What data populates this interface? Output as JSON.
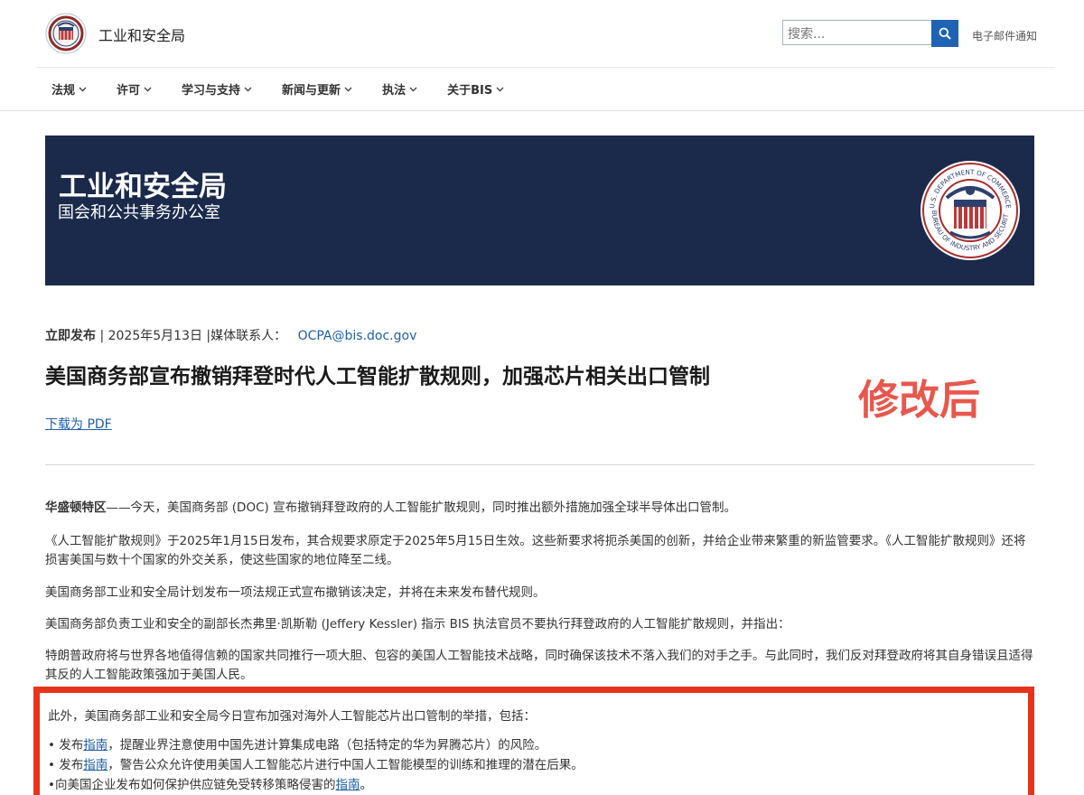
{
  "header": {
    "site_name": "工业和安全局",
    "search_placeholder": "搜索...",
    "email_link": "电子邮件通知"
  },
  "nav": [
    {
      "label": "法规"
    },
    {
      "label": "许可"
    },
    {
      "label": "学习与支持"
    },
    {
      "label": "新闻与更新"
    },
    {
      "label": "执法"
    },
    {
      "label": "关于BIS"
    }
  ],
  "banner": {
    "title": "工业和安全局",
    "subtitle": "国会和公共事务办公室",
    "seal_text_top": "U.S. DEPARTMENT OF COMMERCE",
    "seal_text_bottom": "BUREAU OF INDUSTRY AND SECURITY"
  },
  "meta": {
    "release_label": "立即发布",
    "date": "| 2025年5月13日 |媒体联系人：",
    "email": "OCPA@bis.doc.gov"
  },
  "headline": "美国商务部宣布撤销拜登时代人工智能扩散规则，加强芯片相关出口管制",
  "stamp": "修改后",
  "pdf_link": "下载为 PDF",
  "body": {
    "p1_lead": "华盛顿特区",
    "p1_rest": "——今天，美国商务部 (DOC) 宣布撤销拜登政府的人工智能扩散规则，同时推出额外措施加强全球半导体出口管制。",
    "p2": "《人工智能扩散规则》于2025年1月15日发布，其合规要求原定于2025年5月15日生效。这些新要求将扼杀美国的创新，并给企业带来繁重的新监管要求。《人工智能扩散规则》还将损害美国与数十个国家的外交关系，使这些国家的地位降至二线。",
    "p3": "美国商务部工业和安全局计划发布一项法规正式宣布撤销该决定，并将在未来发布替代规则。",
    "p4": "美国商务部负责工业和安全的副部长杰弗里·凯斯勒 (Jeffery Kessler) 指示 BIS 执法官员不要执行拜登政府的人工智能扩散规则，并指出：",
    "p5": "特朗普政府将与世界各地值得信赖的国家共同推行一项大胆、包容的美国人工智能技术战略，同时确保该技术不落入我们的对手之手。与此同时，我们反对拜登政府将其自身错误且适得其反的人工智能政策强加于美国人民。"
  },
  "box": {
    "intro": "此外，美国商务部工业和安全局今日宣布加强对海外人工智能芯片出口管制的举措，包括：",
    "b1_pre": "• 发布",
    "b1_link": "指南",
    "b1_post": "，提醒业界注意使用中国先进计算集成电路（包括特定的华为昇腾芯片）的风险。",
    "b2_pre": "• 发布",
    "b2_link": "指南",
    "b2_post": "，警告公众允许使用美国人工智能芯片进行中国人工智能模型的训练和推理的潜在后果。",
    "b3_pre": "•向美国企业发布如何保护供应链免受转移策略侵害的",
    "b3_link": "指南",
    "b3_post": "。"
  }
}
